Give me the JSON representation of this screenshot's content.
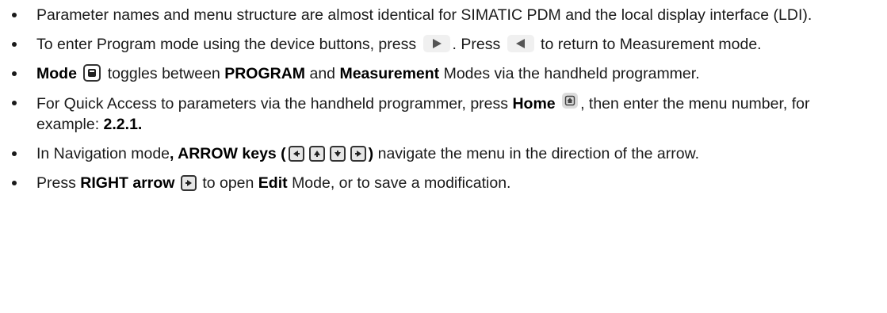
{
  "bullets": [
    {
      "text": "Parameter names and menu structure are almost identical for SIMATIC PDM and the local display interface (LDI)."
    },
    {
      "part1": "To enter Program mode using the device buttons, press",
      "part2": ". Press",
      "part3": "to return to Measurement mode.",
      "icons": [
        "right-triangle-key-icon",
        "left-triangle-key-icon"
      ]
    },
    {
      "bold1": "Mode",
      "part1": "toggles between",
      "bold2": "PROGRAM",
      "part2": "and",
      "bold3": "Measurement",
      "part3": "Modes via the handheld programmer.",
      "icons": [
        "mode-key-icon"
      ]
    },
    {
      "part1": "For Quick Access to parameters via the handheld programmer, press",
      "bold1": "Home",
      "part2": ", then enter the menu number, for example:",
      "bold2": "2.2.1.",
      "icons": [
        "home-key-icon"
      ]
    },
    {
      "part1": "In Navigation mode",
      "bold1": ", ARROW keys (",
      "bold2": ")",
      "part2": "navigate the menu in the direction of the arrow.",
      "icons": [
        "left-arrow-key-icon",
        "up-arrow-key-icon",
        "down-arrow-key-icon",
        "right-arrow-key-icon"
      ]
    },
    {
      "part1": "Press",
      "bold1": "RIGHT arrow",
      "part2": "to open",
      "bold2": "Edit",
      "part3": "Mode, or to save a modification.",
      "icons": [
        "right-arrow-key-icon"
      ]
    }
  ]
}
